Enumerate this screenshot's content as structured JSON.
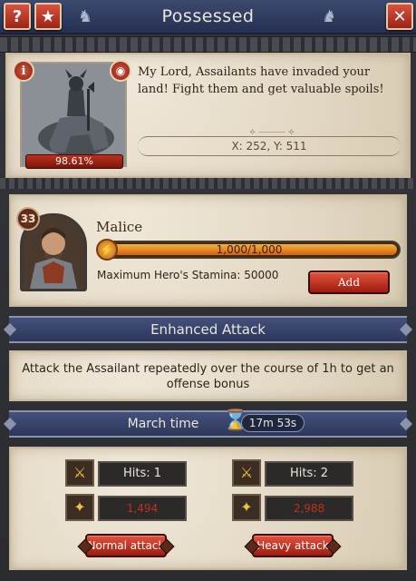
{
  "header": {
    "title": "Possessed",
    "help_label": "?",
    "close_label": "✕"
  },
  "target": {
    "health_percent": "98.61%",
    "message": "My Lord, Assailants have invaded your land! Fight them and get valuable spoils!",
    "coordinates": "X: 252, Y: 511"
  },
  "hero": {
    "level": "33",
    "name": "Malice",
    "stamina_text": "1,000/1,000",
    "stamina_fraction": 1.0,
    "max_stamina_text": "Maximum Hero's Stamina: 50000",
    "add_label": "Add"
  },
  "enhanced": {
    "title": "Enhanced Attack",
    "description": "Attack the Assailant repeatedly over the course of 1h to get an offense bonus"
  },
  "march": {
    "label": "March time",
    "value": "17m 53s"
  },
  "attacks": {
    "normal": {
      "hits": "Hits: 1",
      "power": "1,494",
      "button": "Normal attack"
    },
    "heavy": {
      "hits": "Hits: 2",
      "power": "2,988",
      "button": "Heavy attack"
    }
  },
  "colors": {
    "accent_red": "#c0301c",
    "banner_blue": "#2c375a",
    "parchment": "#e6dccb",
    "stamina_orange": "#f5b13a"
  }
}
